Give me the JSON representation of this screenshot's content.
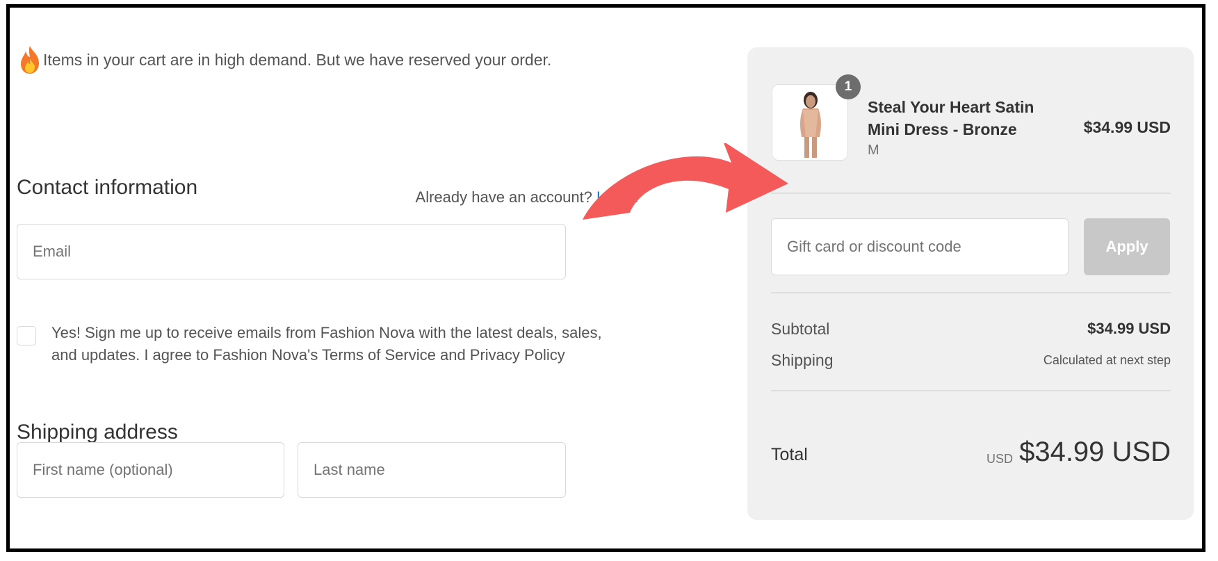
{
  "banner": {
    "icon": "fire-icon",
    "text": "Items in your cart are in high demand. But we have reserved your order."
  },
  "contact": {
    "title": "Contact information",
    "account_prompt": "Already have an account?",
    "login_link": "Log in",
    "email_placeholder": "Email",
    "marketing_consent": "Yes! Sign me up to receive emails from Fashion Nova with the latest deals, sales, and updates. I agree to Fashion Nova's Terms of Service and Privacy Policy"
  },
  "shipping": {
    "title": "Shipping address",
    "first_name_placeholder": "First name (optional)",
    "last_name_placeholder": "Last name"
  },
  "summary": {
    "item": {
      "quantity": "1",
      "name": "Steal Your Heart Satin Mini Dress - Bronze",
      "variant": "M",
      "price": "$34.99 USD"
    },
    "discount_placeholder": "Gift card or discount code",
    "apply_label": "Apply",
    "subtotal_label": "Subtotal",
    "subtotal_value": "$34.99 USD",
    "shipping_label": "Shipping",
    "shipping_value": "Calculated at next step",
    "total_label": "Total",
    "total_currency": "USD",
    "total_value": "$34.99 USD"
  },
  "colors": {
    "link": "#1878b9",
    "arrow": "#f55a5a",
    "summary_bg": "#f0f0f0",
    "apply_bg": "#c8c8c8"
  }
}
